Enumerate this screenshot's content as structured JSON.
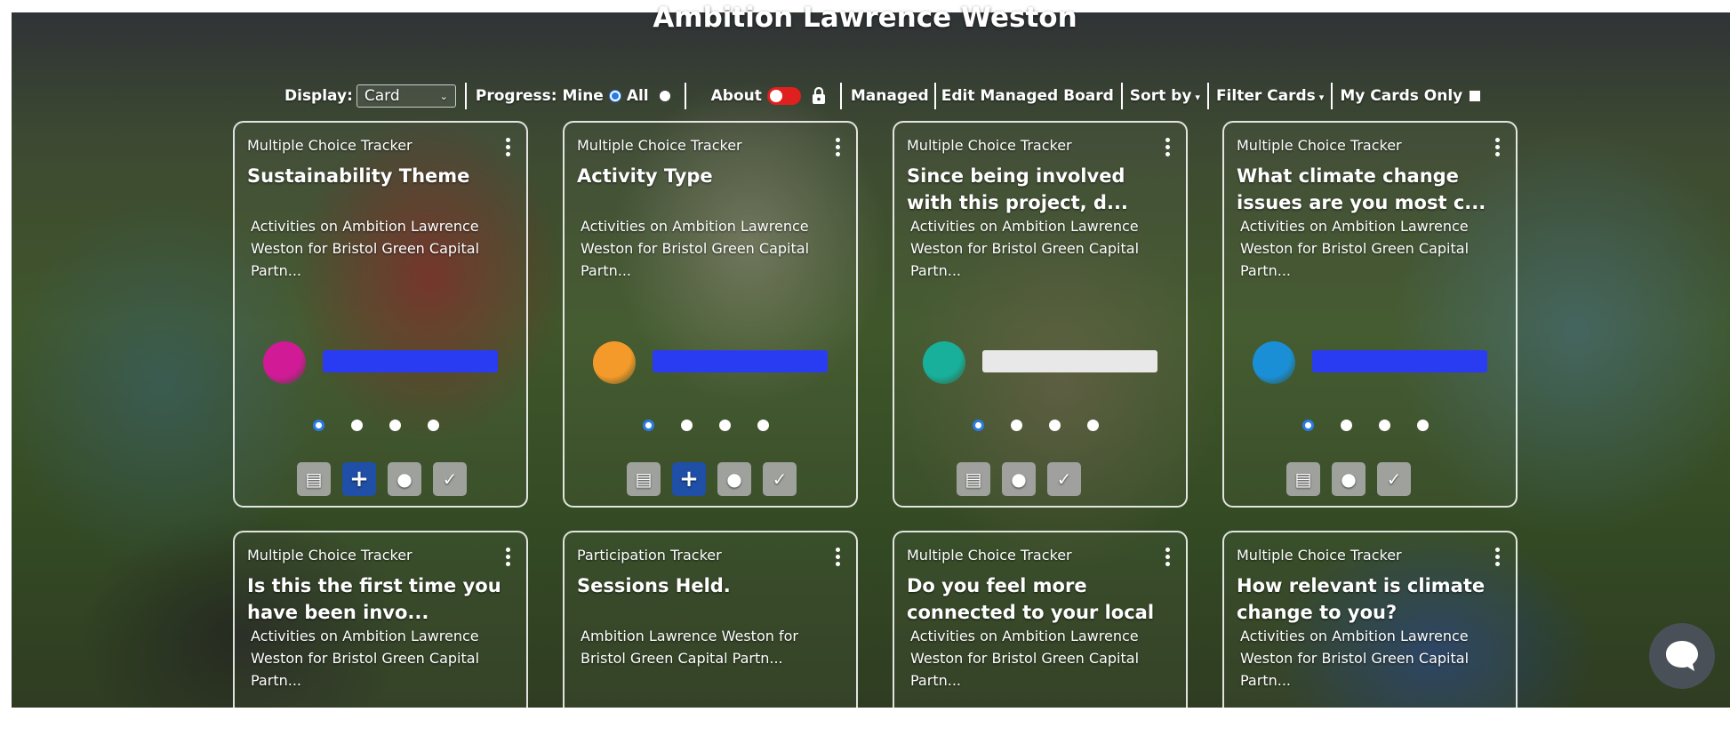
{
  "header": {
    "title": "Ambition Lawrence Weston"
  },
  "toolbar": {
    "display_label": "Display:",
    "display_value": "Card",
    "progress_label": "Progress: Mine",
    "all_label": "All",
    "about_label": "About",
    "managed_label": "Managed",
    "edit_managed_label": "Edit Managed Board",
    "sort_label": "Sort by",
    "filter_label": "Filter Cards",
    "my_cards_label": "My Cards Only"
  },
  "cards": [
    {
      "type": "Multiple Choice Tracker",
      "title": "Sustainability Theme",
      "desc": "Activities on Ambition Lawrence Weston for Bristol Green Capital Partn...",
      "color": "#d11a96",
      "bar_fill": 1.0,
      "actions": [
        "comment-icon",
        "plus-icon",
        "lightbulb-icon",
        "checkbox-icon"
      ]
    },
    {
      "type": "Multiple Choice Tracker",
      "title": "Activity Type",
      "desc": "Activities on Ambition Lawrence Weston for Bristol Green Capital Partn...",
      "color": "#f39a2a",
      "bar_fill": 1.0,
      "actions": [
        "comment-icon",
        "plus-icon",
        "lightbulb-icon",
        "checkbox-icon"
      ]
    },
    {
      "type": "Multiple Choice Tracker",
      "title": "Since being involved with this project, d...",
      "desc": "Activities on Ambition Lawrence Weston for Bristol Green Capital Partn...",
      "color": "#18b09a",
      "bar_fill": 0,
      "actions": [
        "comment-icon",
        "lightbulb-icon",
        "checkbox-icon"
      ]
    },
    {
      "type": "Multiple Choice Tracker",
      "title": "What climate change issues are you most c...",
      "desc": "Activities on Ambition Lawrence Weston for Bristol Green Capital Partn...",
      "color": "#1a8fd6",
      "bar_fill": 1.0,
      "actions": [
        "comment-icon",
        "lightbulb-icon",
        "checkbox-icon"
      ]
    },
    {
      "type": "Multiple Choice Tracker",
      "title": "Is this the first time you have been invo...",
      "desc": "Activities on Ambition Lawrence Weston for Bristol Green Capital Partn..."
    },
    {
      "type": "Participation Tracker",
      "title": "Sessions Held.",
      "desc": "Ambition Lawrence Weston for Bristol Green Capital Partn..."
    },
    {
      "type": "Multiple Choice Tracker",
      "title": "Do you feel more connected to your local",
      "desc": "Activities on Ambition Lawrence Weston for Bristol Green Capital Partn..."
    },
    {
      "type": "Multiple Choice Tracker",
      "title": "How relevant is climate change to you?",
      "desc": "Activities on Ambition Lawrence Weston for Bristol Green Capital Partn..."
    }
  ]
}
